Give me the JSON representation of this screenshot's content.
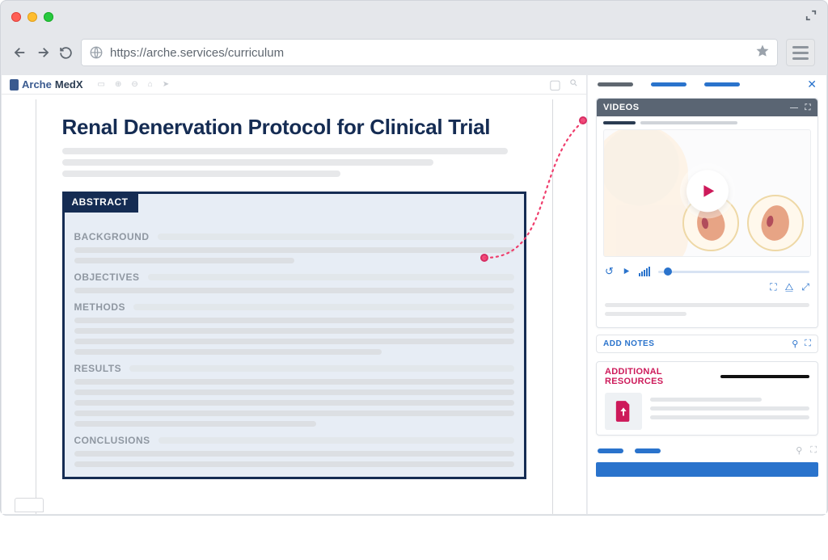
{
  "browser": {
    "url": "https://arche.services/curriculum"
  },
  "brand": {
    "part1": "Arche",
    "part2": "MedX"
  },
  "document": {
    "title": "Renal Denervation Protocol for Clinical Trial",
    "abstract_label": "ABSTRACT",
    "sections": {
      "background": "BACKGROUND",
      "objectives": "OBJECTIVES",
      "methods": "METHODS",
      "results": "RESULTS",
      "conclusions": "CONCLUSIONS"
    }
  },
  "sidebar": {
    "videos_label": "VIDEOS",
    "add_notes_label": "ADD NOTES",
    "additional_resources_label": "ADDITIONAL RESOURCES"
  }
}
